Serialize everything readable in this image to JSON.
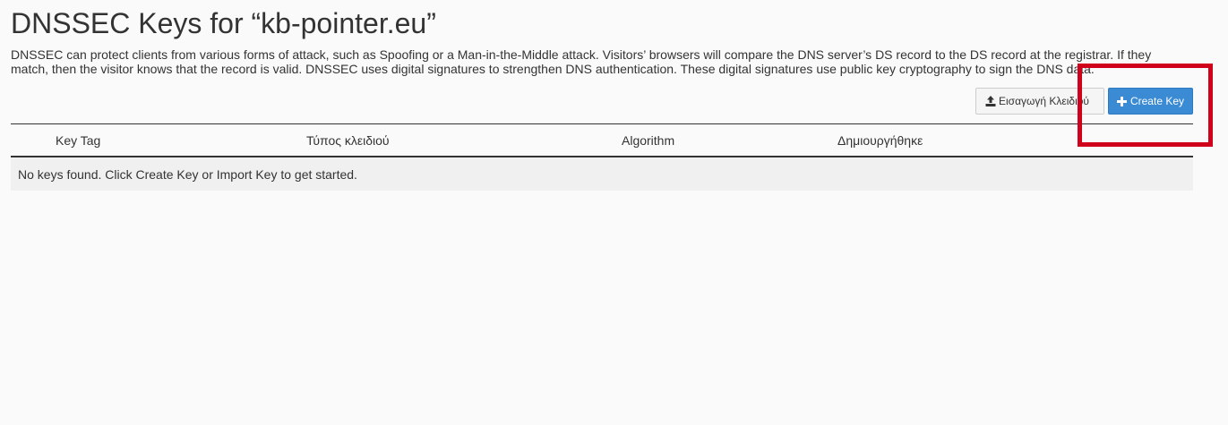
{
  "page": {
    "title": "DNSSEC Keys for “kb-pointer.eu”",
    "description": "DNSSEC can protect clients from various forms of attack, such as Spoofing or a Man-in-the-Middle attack. Visitors’ browsers will compare the DNS server’s DS record to the DS record at the registrar. If they match, then the visitor knows that the record is valid. DNSSEC uses digital signatures to strengthen DNS authentication. These digital signatures use public key cryptography to sign the DNS data."
  },
  "toolbar": {
    "import_label": "Εισαγωγή Κλειδιού",
    "import_icon": "upload-icon",
    "create_label": "Create Key",
    "create_icon": "plus-icon"
  },
  "table": {
    "columns": [
      "Key Tag",
      "Τύπος κλειδιού",
      "Algorithm",
      "Δημιουργήθηκε"
    ],
    "empty_message": "No keys found. Click Create Key or Import Key to get started."
  },
  "annotation": {
    "highlight_color": "#d0021b"
  },
  "colors": {
    "primary": "#3a8bd4",
    "background": "#fafafa"
  }
}
